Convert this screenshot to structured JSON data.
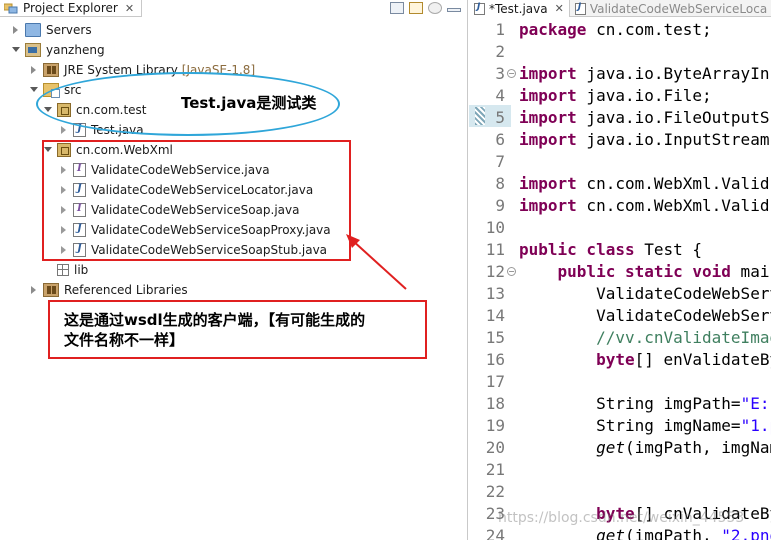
{
  "explorer": {
    "tab_title": "Project Explorer",
    "tab_close": "✕"
  },
  "tree": {
    "servers": "Servers",
    "project": "yanzheng",
    "jre": "JRE System Library",
    "jre_deco": "[JavaSE-1.8]",
    "src": "src",
    "pkg_test": "cn.com.test",
    "test_java": "Test.java",
    "pkg_webxml": "cn.com.WebXml",
    "files": [
      "ValidateCodeWebService.java",
      "ValidateCodeWebServiceLocator.java",
      "ValidateCodeWebServiceSoap.java",
      "ValidateCodeWebServiceSoapProxy.java",
      "ValidateCodeWebServiceSoapStub.java"
    ],
    "lib": "lib",
    "ref_libs": "Referenced Libraries"
  },
  "annotations": {
    "ellipse_text": "Test.java是测试类",
    "note_line1": "这是通过wsdl生成的客户端，【有可能生成的",
    "note_line2": "文件名称不一样】",
    "ellipse_color": "#2fa6d9",
    "box_color": "#e02020"
  },
  "editor": {
    "tab_active": "*Test.java",
    "tab_close": "✕",
    "tab_inactive": "ValidateCodeWebServiceLoca",
    "line_numbers": [
      "1",
      "2",
      "3",
      "4",
      "5",
      "6",
      "7",
      "8",
      "9",
      "10",
      "11",
      "12",
      "13",
      "14",
      "15",
      "16",
      "17",
      "18",
      "19",
      "20",
      "21",
      "22",
      "23",
      "24"
    ],
    "code": {
      "l1_kw": "package",
      "l1_rest": " cn.com.test;",
      "l3_kw": "import",
      "l3_rest": " java.io.ByteArrayIn",
      "l4_kw": "import",
      "l4_rest": " java.io.File;",
      "l5_kw": "import",
      "l5_rest": " java.io.FileOutputS",
      "l6_kw": "import",
      "l6_rest": " java.io.InputStream",
      "l8_kw": "import",
      "l8_rest": " cn.com.WebXml.Valid",
      "l9_kw": "import",
      "l9_rest": " cn.com.WebXml.Valid",
      "l11_kw": "public class",
      "l11_rest": " Test {",
      "l12_kw": "    public static void",
      "l12_rest": " main",
      "l13": "        ValidateCodeWebServ",
      "l14": "        ValidateCodeWebServ",
      "l15": "        //vv.cnValidateImag",
      "l16_kw": "        byte",
      "l16_rest": "[] enValidateBy",
      "l18_a": "        String ",
      "l18_b": "imgPath=",
      "l18_c": "\"E:",
      "l19_a": "        String ",
      "l19_b": "imgName=",
      "l19_c": "\"1.p",
      "l20_a": "        ",
      "l20_b": "get",
      "l20_c": "(imgPath, imgNam",
      "l23_kw": "        byte",
      "l23_rest": "[] cnValidateBy",
      "l24_a": "        ",
      "l24_b": "get",
      "l24_c": "(imgPath, ",
      "l24_d": "\"2.png"
    }
  },
  "watermark": "https://blog.csdn.net/weixin_44553"
}
